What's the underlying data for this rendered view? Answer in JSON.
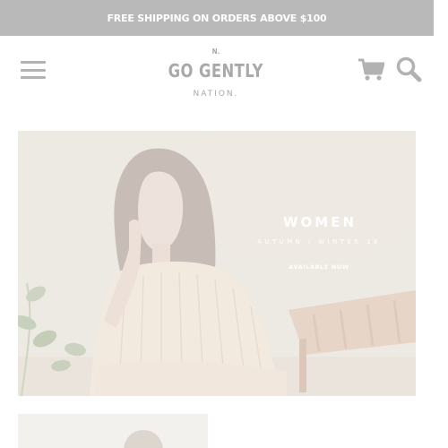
{
  "announcement": {
    "text": "FREE SHIPPING ON ORDERS ABOVE $100"
  },
  "header": {
    "logo_mark": "N.",
    "logo_main": "GO GENTLY",
    "logo_sub": "NATION."
  },
  "icons": {
    "menu": "hamburger-icon",
    "cart": "cart-icon",
    "search": "search-icon"
  },
  "hero": {
    "title": "WOMEN",
    "subtitle": "AUTUMN / WINTER 18",
    "cta": "AVAILABLE NOW"
  },
  "colors": {
    "announcement_bg": "#b9b9b9",
    "icon_gray": "#b2b2b2",
    "logo_gray": "#a9a9a9"
  }
}
